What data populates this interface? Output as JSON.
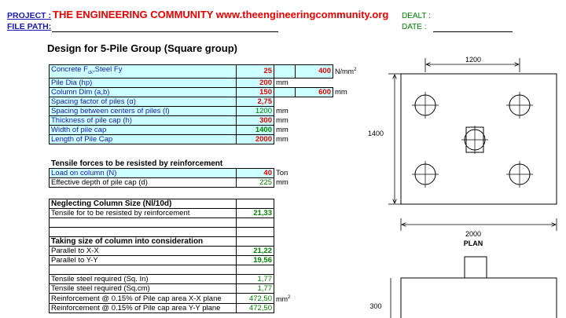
{
  "header": {
    "project_label": "PROJECT  :",
    "project_value": "THE ENGINEERING COMMUNITY www.theengineeringcommunity.org",
    "filepath_label": "FILE PATH:",
    "dealt_label": "DEALT   :",
    "date_label": "DATE    :"
  },
  "title": "Design for 5-Pile Group (Square group)",
  "inputs": {
    "concrete_label": "Concrete F",
    "concrete_sub": "ck",
    "concrete_rest": ",Steel  Fy",
    "concrete_val": "25",
    "steel_val": "400",
    "stress_unit": "N/mm",
    "stress_sup": "2",
    "pile_dia_label": "Pile Dia (hp)",
    "pile_dia_val": "200",
    "pile_dia_unit": "mm",
    "col_dim_label": "Column Dim (a,b)",
    "col_a_val": "150",
    "col_b_val": "600",
    "col_unit": "mm",
    "spacing_factor_label": "Spacing factor of piles (α)",
    "spacing_factor_val": "2,75",
    "spacing_label": "Spacing between centers of piles (l)",
    "spacing_val": "1200",
    "spacing_unit": "mm",
    "thickness_label": "Thickness of pile cap (h)",
    "thickness_val": "300",
    "thickness_unit": "mm",
    "width_label": "Width of pile cap",
    "width_val": "1400",
    "width_unit": "mm",
    "length_label": "Length of Pile Cap",
    "length_val": "2000",
    "length_unit": "mm"
  },
  "tensile": {
    "heading": "Tensile forces to be resisted by reinforcement",
    "load_label": "Load on column (N)",
    "load_val": "40",
    "load_unit": "Ton",
    "depth_label": "Effective depth of pile cap (d)",
    "depth_val": "225",
    "depth_unit": "mm"
  },
  "neglect": {
    "heading": "Neglecting Column Size (Nl/10d)",
    "tensile_label": "Tensile for to be resisted by reinforcement",
    "tensile_val": "21,33"
  },
  "consider": {
    "heading": "Taking size of column into consideration",
    "xx_label": "Parallel to X-X",
    "xx_val": "21,22",
    "yy_label": "Parallel to Y-Y",
    "yy_val": "19,56"
  },
  "steel": {
    "sq_in_label": "Tensile steel required (Sq. In)",
    "sq_in_val": "1,77",
    "sq_cm_label": "Tensile steel required (Sq.cm)",
    "sq_cm_val": "1,77",
    "reinf_x_label": "Reinforcement @ 0.15% of Pile cap area X-X plane",
    "reinf_x_val": "472,50",
    "reinf_unit": "mm",
    "reinf_sup": "2",
    "reinf_y_label": "Reinforcement @ 0.15% of Pile cap area Y-Y plane",
    "reinf_y_val": "472,50"
  },
  "drawing": {
    "dim_top": "1200",
    "dim_left": "1400",
    "dim_bottom": "2000",
    "plan_label": "PLAN",
    "dim_section": "300"
  }
}
